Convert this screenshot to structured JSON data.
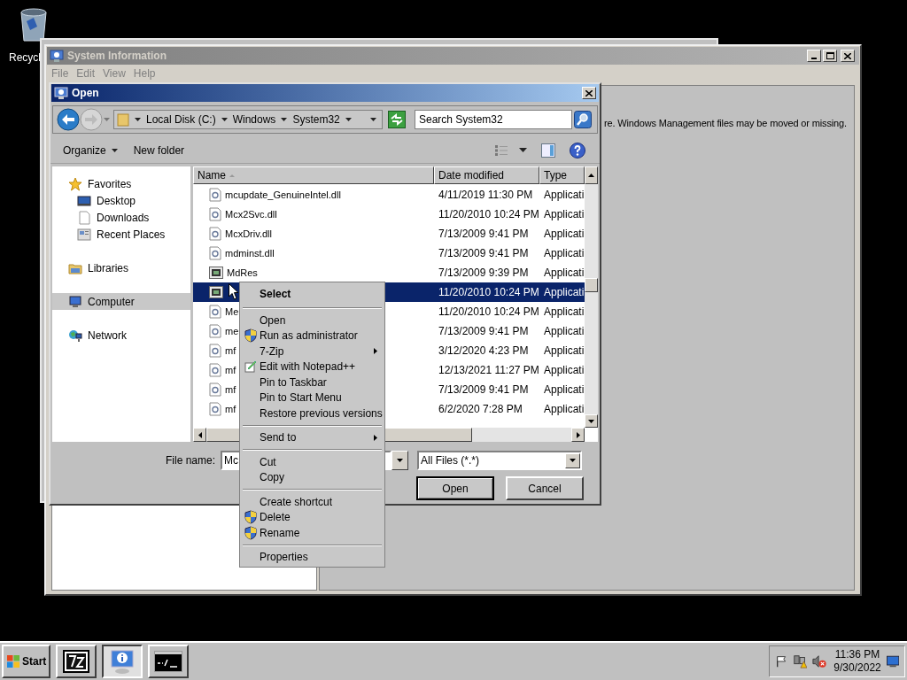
{
  "desktop_icons": [
    {
      "label": "Recycl"
    }
  ],
  "system_information": {
    "title": "System Information",
    "menu": [
      "File",
      "Edit",
      "View",
      "Help"
    ],
    "message": "re. Windows Management files may be moved or missing."
  },
  "open_dialog": {
    "title": "Open",
    "address": [
      "Local Disk (C:)",
      "Windows",
      "System32"
    ],
    "search": {
      "placeholder": "Search System32"
    },
    "toolbar": [
      "Organize",
      "New folder"
    ],
    "nav": [
      {
        "label": "Favorites",
        "kind": "star",
        "selected": false,
        "children": [
          {
            "label": "Desktop",
            "kind": "desktop",
            "selected": false
          },
          {
            "label": "Downloads",
            "kind": "document",
            "selected": false
          },
          {
            "label": "Recent Places",
            "kind": "recent",
            "selected": false
          }
        ]
      },
      {
        "label": "Libraries",
        "kind": "library",
        "selected": false
      },
      {
        "label": "Computer",
        "kind": "computer",
        "selected": true
      },
      {
        "label": "Network",
        "kind": "network",
        "selected": false
      }
    ],
    "columns": [
      "Name",
      "Date modified",
      "Type"
    ],
    "rows": [
      {
        "name": "mcupdate_GenuineIntel.dll",
        "date": "4/11/2019 11:30 PM",
        "type": "Applicati",
        "kind": "dll",
        "selected": false
      },
      {
        "name": "Mcx2Svc.dll",
        "date": "11/20/2010 10:24 PM",
        "type": "Applicati",
        "kind": "dll",
        "selected": false
      },
      {
        "name": "McxDriv.dll",
        "date": "7/13/2009 9:41 PM",
        "type": "Applicati",
        "kind": "dll",
        "selected": false
      },
      {
        "name": "mdminst.dll",
        "date": "7/13/2009 9:41 PM",
        "type": "Applicati",
        "kind": "dll",
        "selected": false
      },
      {
        "name": "MdRes",
        "date": "7/13/2009 9:39 PM",
        "type": "Applicati",
        "kind": "exe",
        "selected": false
      },
      {
        "date": "11/20/2010 10:24 PM",
        "type": "Applicati",
        "kind": "exe",
        "selected": true
      },
      {
        "name": "Me",
        "date": "11/20/2010 10:24 PM",
        "type": "Applicati",
        "kind": "dll",
        "selected": false
      },
      {
        "name": "me",
        "date": "7/13/2009 9:41 PM",
        "type": "Applicati",
        "kind": "dll",
        "selected": false
      },
      {
        "name": "mf",
        "date": "3/12/2020 4:23 PM",
        "type": "Applicati",
        "kind": "dll",
        "selected": false
      },
      {
        "name": "mf",
        "date": "12/13/2021 11:27 PM",
        "type": "Applicati",
        "kind": "dll",
        "selected": false
      },
      {
        "name": "mf",
        "date": "7/13/2009 9:41 PM",
        "type": "Applicati",
        "kind": "dll",
        "selected": false
      },
      {
        "name": "mf",
        "date": "6/2/2020 7:28 PM",
        "type": "Applicati",
        "kind": "dll",
        "selected": false
      }
    ],
    "file_name": {
      "label": "File name:",
      "value": "Mc"
    },
    "file_type": "All Files (*.*)",
    "buttons": [
      "Open",
      "Cancel"
    ]
  },
  "context_menu": [
    {
      "kind": "item",
      "label": "Select",
      "bold": true
    },
    {
      "kind": "separator"
    },
    {
      "kind": "item",
      "label": "Open"
    },
    {
      "kind": "shield-item",
      "label": "Run as administrator"
    },
    {
      "kind": "item",
      "label": "7-Zip",
      "submenu": true
    },
    {
      "kind": "notepad-item",
      "label": "Edit with Notepad++"
    },
    {
      "kind": "item",
      "label": "Pin to Taskbar"
    },
    {
      "kind": "item",
      "label": "Pin to Start Menu"
    },
    {
      "kind": "item",
      "label": "Restore previous versions"
    },
    {
      "kind": "separator"
    },
    {
      "kind": "item",
      "label": "Send to",
      "submenu": true
    },
    {
      "kind": "separator"
    },
    {
      "kind": "item",
      "label": "Cut"
    },
    {
      "kind": "item",
      "label": "Copy"
    },
    {
      "kind": "separator"
    },
    {
      "kind": "item",
      "label": "Create shortcut"
    },
    {
      "kind": "shield-item",
      "label": "Delete"
    },
    {
      "kind": "shield-item",
      "label": "Rename"
    },
    {
      "kind": "separator"
    },
    {
      "kind": "item",
      "label": "Properties"
    }
  ],
  "taskbar": {
    "start": "Start",
    "tasks": [
      {
        "kind": "sevenzip",
        "selected": false
      },
      {
        "kind": "sysinfo",
        "selected": true
      },
      {
        "kind": "console",
        "selected": false
      }
    ],
    "time": "11:36 PM",
    "date": "9/30/2022"
  }
}
